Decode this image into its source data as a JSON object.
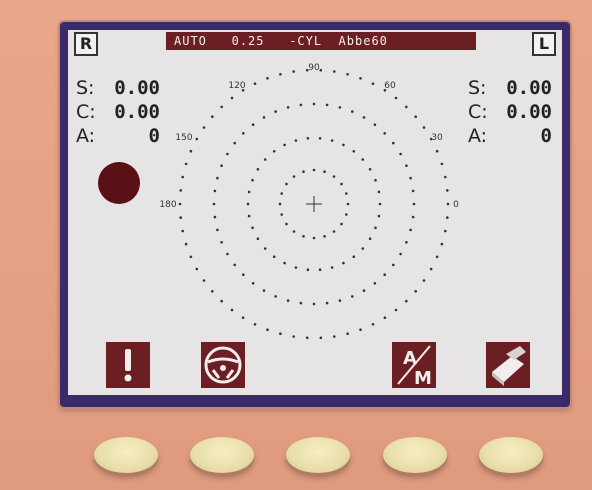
{
  "header": {
    "mode": "AUTO",
    "step": "0.25",
    "cyl_sign": "-CYL",
    "abbe": "Abbe60"
  },
  "eyes": {
    "right": "R",
    "left": "L"
  },
  "right_eye_readings": {
    "sphere_label": "S:",
    "sphere": "0.00",
    "cylinder_label": "C:",
    "cylinder": "0.00",
    "axis_label": "A:",
    "axis": "0"
  },
  "left_eye_readings": {
    "sphere_label": "S:",
    "sphere": "0.00",
    "cylinder_label": "C:",
    "cylinder": "0.00",
    "axis_label": "A:",
    "axis": "0"
  },
  "target": {
    "angles": [
      "90",
      "120",
      "60",
      "150",
      "30",
      "180",
      "0"
    ]
  },
  "softkeys": [
    {
      "icon": "exclamation-icon"
    },
    {
      "icon": "steering-wheel-icon"
    },
    {
      "icon": "blank"
    },
    {
      "icon": "auto-manual-icon",
      "top": "A",
      "bottom": "M"
    },
    {
      "icon": "print-icon"
    }
  ],
  "colors": {
    "screen": "#e6e4e4",
    "accent": "#6b1f22",
    "bezel": "#3a2a6a",
    "device": "#e8a68c",
    "button": "#e8dea8"
  }
}
